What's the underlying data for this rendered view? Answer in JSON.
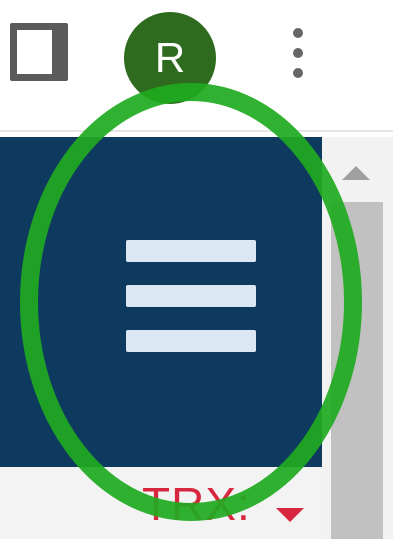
{
  "toolbar": {
    "tab_icon": "tab-square-icon",
    "avatar_initial": "R",
    "menu_icon": "kebab-menu-icon"
  },
  "panel": {
    "background": "#0f3a60",
    "menu_icon": "hamburger-menu-icon"
  },
  "footer": {
    "ticker_label": "TRX:",
    "ticker_color": "#d7263d",
    "caret_icon": "caret-down-icon"
  },
  "annotation": {
    "shape": "ellipse",
    "color": "#1faa1f"
  }
}
